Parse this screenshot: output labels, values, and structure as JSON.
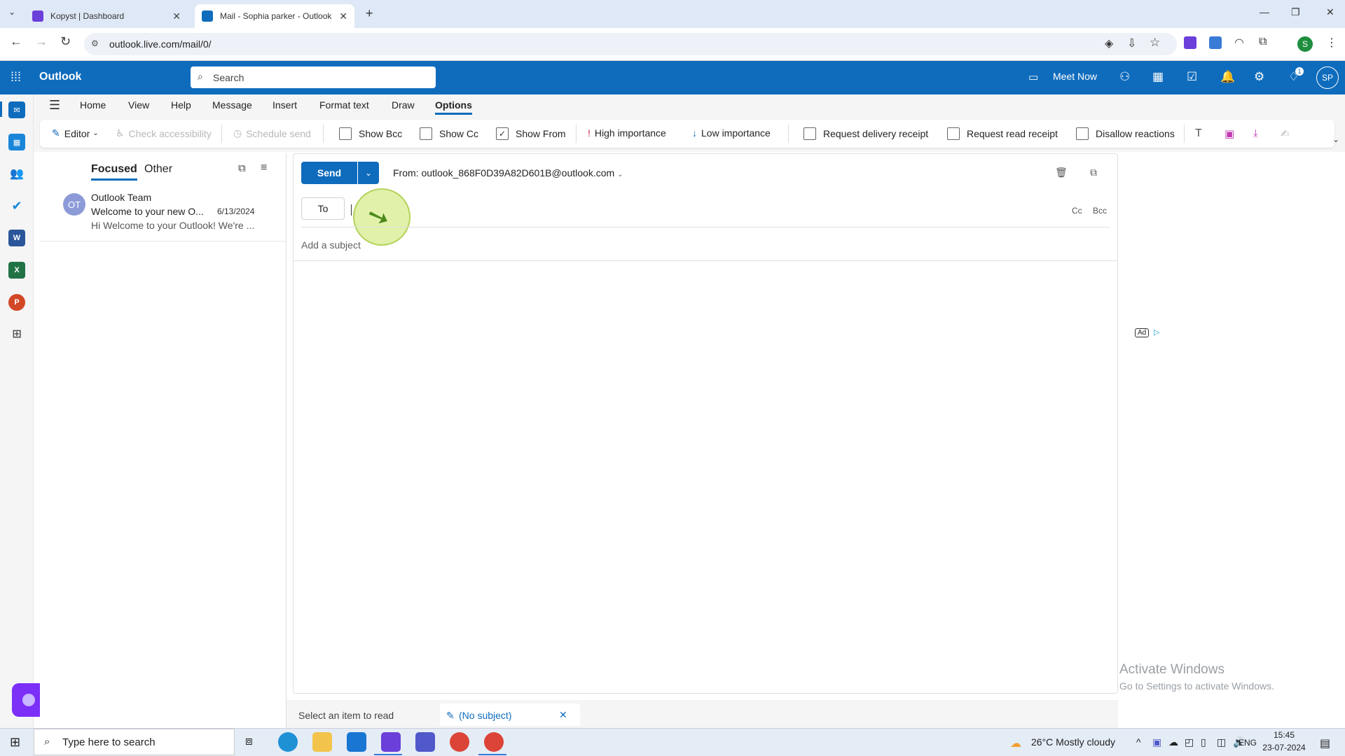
{
  "browser": {
    "tabs": [
      {
        "title": "Kopyst | Dashboard"
      },
      {
        "title": "Mail - Sophia parker - Outlook"
      }
    ],
    "url": "outlook.live.com/mail/0/"
  },
  "outlook": {
    "brand": "Outlook",
    "search_placeholder": "Search",
    "meet_now": "Meet Now",
    "avatar": "SP",
    "badge": "1"
  },
  "ribbon": {
    "menus": [
      "Home",
      "View",
      "Help",
      "Message",
      "Insert",
      "Format text",
      "Draw",
      "Options"
    ],
    "selected_menu": "Options",
    "editor": "Editor",
    "check_accessibility": "Check accessibility",
    "schedule_send": "Schedule send",
    "show_bcc": "Show Bcc",
    "show_cc": "Show Cc",
    "show_from": "Show From",
    "high_importance": "High importance",
    "low_importance": "Low importance",
    "request_delivery": "Request delivery receipt",
    "request_read": "Request read receipt",
    "disallow_reactions": "Disallow reactions"
  },
  "list": {
    "focused": "Focused",
    "other": "Other",
    "message": {
      "initials": "OT",
      "sender": "Outlook Team",
      "subject": "Welcome to your new O...",
      "date": "6/13/2024",
      "preview": "Hi Welcome to your Outlook! We're ..."
    }
  },
  "compose": {
    "send": "Send",
    "from": "From: outlook_868F0D39A82D601B@outlook.com",
    "to": "To",
    "cc": "Cc",
    "bcc": "Bcc",
    "subject_placeholder": "Add a subject",
    "ad": "Ad"
  },
  "bottom_tabs": {
    "select_item": "Select an item to read",
    "no_subject": "(No subject)"
  },
  "watermark": {
    "line1": "Activate Windows",
    "line2": "Go to Settings to activate Windows."
  },
  "taskbar": {
    "search_placeholder": "Type here to search",
    "weather": "26°C  Mostly cloudy",
    "lang": "ENG",
    "time": "15:45",
    "date": "23-07-2024"
  }
}
